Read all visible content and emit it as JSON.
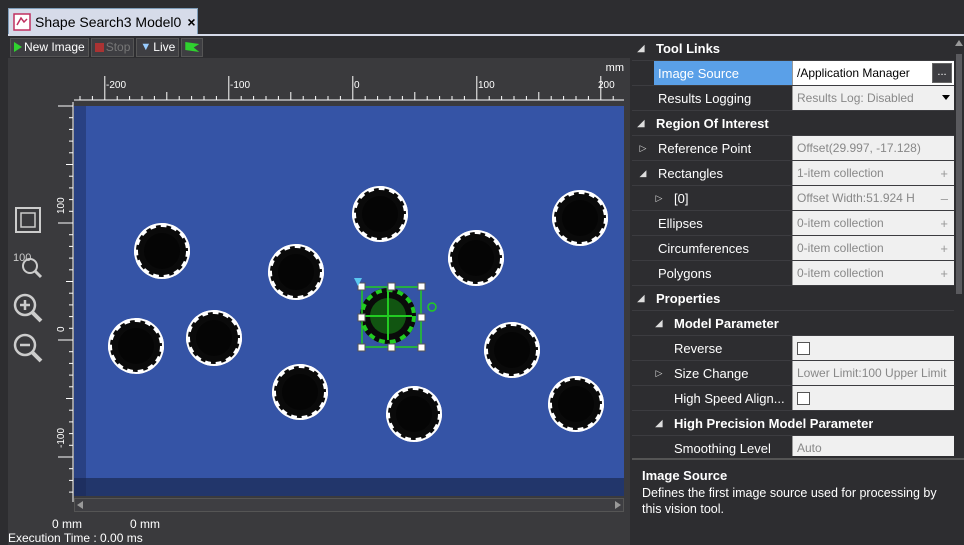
{
  "tab": {
    "title": "Shape Search3 Model0",
    "close": "×"
  },
  "toolbar": {
    "new_image": "New Image",
    "stop": "Stop",
    "live": "Live"
  },
  "ruler": {
    "unit": "mm",
    "h_labels": [
      "-200",
      "-100",
      "0",
      "100",
      "200"
    ],
    "v_labels": [
      "100",
      "0",
      "-100"
    ]
  },
  "status": {
    "coord_x": "0 mm",
    "coord_y": "0 mm",
    "execution_time": "Execution Time : 0.00 ms"
  },
  "icons": {
    "fit": "fit-to-window-icon",
    "zoom100": "zoom-100-icon",
    "zoomin": "zoom-in-icon",
    "zoomout": "zoom-out-icon"
  },
  "colors": {
    "canvas": "#3554a6",
    "selection": "#5aa0e8",
    "model": "#22cc22"
  },
  "props": {
    "tool_links": "Tool Links",
    "image_source": {
      "name": "Image Source",
      "value": "/Application Manager"
    },
    "results_logging": {
      "name": "Results Logging",
      "value": "Results Log: Disabled"
    },
    "roi": "Region Of Interest",
    "reference_point": {
      "name": "Reference Point",
      "value": "Offset(29.997, -17.128)"
    },
    "rectangles": {
      "name": "Rectangles",
      "value": "1-item collection"
    },
    "rect0": {
      "name": "[0]",
      "value": "Offset Width:51.924 H"
    },
    "ellipses": {
      "name": "Ellipses",
      "value": "0-item collection"
    },
    "circumferences": {
      "name": "Circumferences",
      "value": "0-item collection"
    },
    "polygons": {
      "name": "Polygons",
      "value": "0-item collection"
    },
    "properties": "Properties",
    "model_parameter": "Model Parameter",
    "reverse": {
      "name": "Reverse"
    },
    "size_change": {
      "name": "Size Change",
      "value": "Lower Limit:100 Upper Limit"
    },
    "high_speed": {
      "name": "High Speed Align..."
    },
    "hp_model_parameter": "High Precision Model Parameter",
    "smoothing": {
      "name": "Smoothing Level",
      "value": "Auto"
    }
  },
  "description": {
    "title": "Image Source",
    "body": "Defines the first image source used for processing by this vision tool."
  }
}
